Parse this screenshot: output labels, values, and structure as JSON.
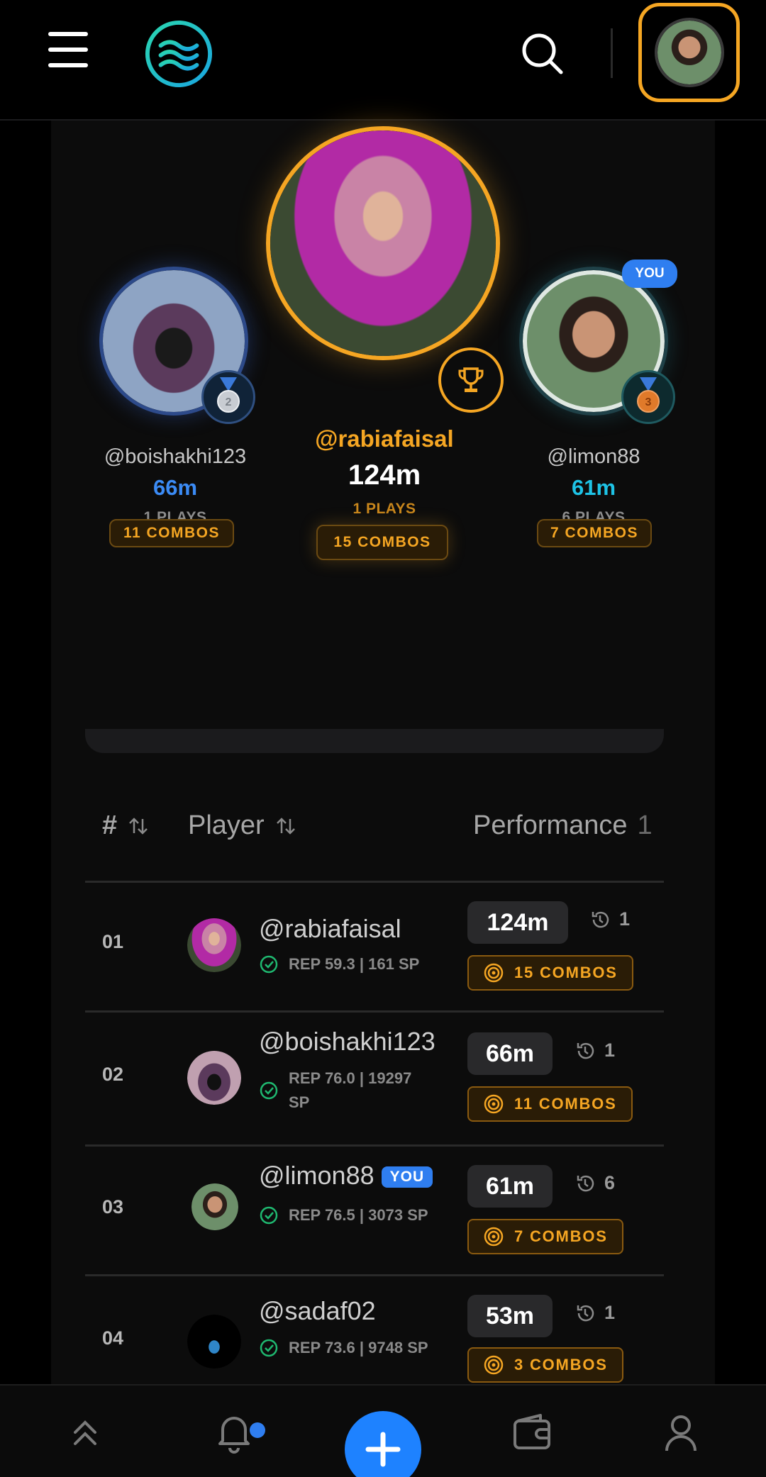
{
  "header": {
    "menu_icon": "hamburger-icon",
    "logo_icon": "wave-logo-icon",
    "search_icon": "search-icon",
    "accent_color": "#f5a623"
  },
  "podium": {
    "first": {
      "username": "@rabiafaisal",
      "distance": "124m",
      "plays": "1 PLAYS",
      "combos": "15 COMBOS",
      "badge_icon": "trophy-icon"
    },
    "second": {
      "username": "@boishakhi123",
      "distance": "66m",
      "plays": "1 PLAYS",
      "combos": "11 COMBOS",
      "badge_icon": "silver-medal-icon",
      "medal_number": "2"
    },
    "third": {
      "username": "@limon88",
      "distance": "61m",
      "plays": "6 PLAYS",
      "combos": "7 COMBOS",
      "badge_icon": "bronze-medal-icon",
      "medal_number": "3",
      "you_label": "YOU"
    }
  },
  "table": {
    "headers": {
      "rank": "#",
      "player": "Player",
      "performance": "Performance",
      "performance_overflow": "1"
    },
    "rows": [
      {
        "rank": "01",
        "username": "@rabiafaisal",
        "rep": "REP 59.3 | 161 SP",
        "distance": "124m",
        "plays": "1",
        "combos": "15 COMBOS"
      },
      {
        "rank": "02",
        "username": "@boishakhi123",
        "rep": "REP 76.0 | 19297 SP",
        "distance": "66m",
        "plays": "1",
        "combos": "11 COMBOS"
      },
      {
        "rank": "03",
        "username": "@limon88",
        "you_label": "YOU",
        "rep": "REP 76.5 | 3073 SP",
        "distance": "61m",
        "plays": "6",
        "combos": "7 COMBOS"
      },
      {
        "rank": "04",
        "username": "@sadaf02",
        "rep": "REP 73.6 | 9748 SP",
        "distance": "53m",
        "plays": "1",
        "combos": "3 COMBOS"
      }
    ]
  },
  "bottom_nav": {
    "items": [
      "chevrons-up-icon",
      "bell-icon",
      "plus-icon",
      "wallet-icon",
      "user-icon"
    ],
    "fab_color": "#1e82ff"
  }
}
